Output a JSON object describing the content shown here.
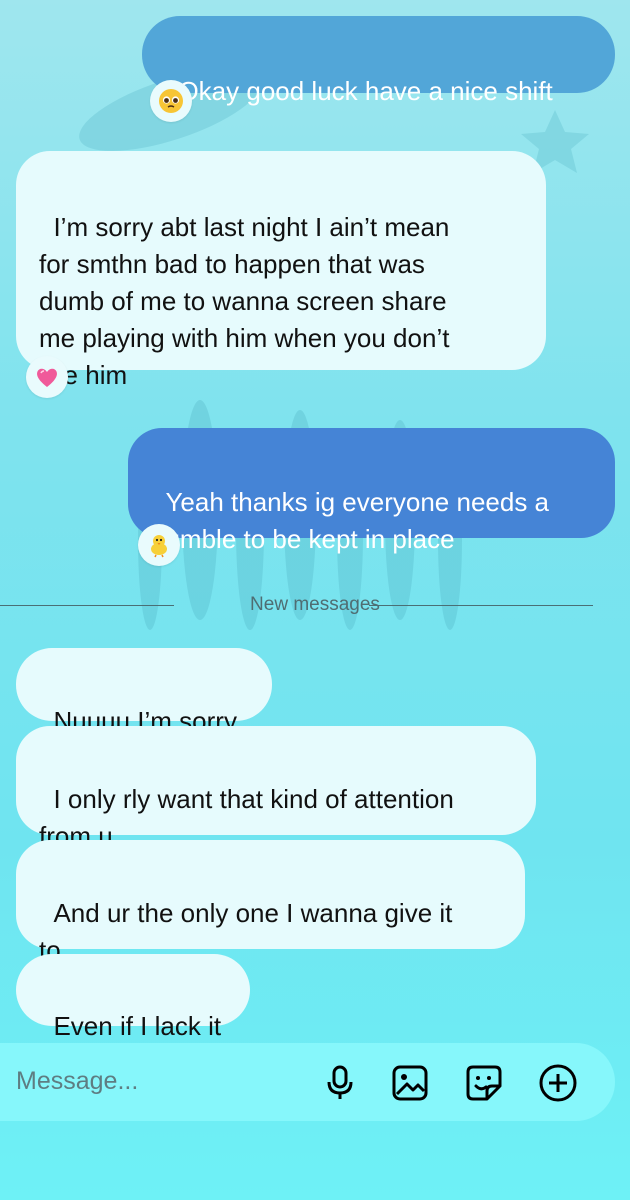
{
  "messages": [
    {
      "direction": "outgoing",
      "text": "Okay good luck have a nice shift",
      "reaction": "🥺"
    },
    {
      "direction": "incoming",
      "text": "I’m sorry abt last night I ain’t mean\nfor smthn bad to happen that was\ndumb of me to wanna screen share\nme playing with him when you don’t\nlike him",
      "reaction": "💗"
    },
    {
      "direction": "outgoing",
      "text": "Yeah thanks ig everyone needs a\nhumble to be kept in place",
      "reaction": "🐥"
    },
    {
      "direction": "incoming",
      "text": "Nuuuu I’m sorry"
    },
    {
      "direction": "incoming",
      "text": "I only rly want that kind of attention\nfrom u"
    },
    {
      "direction": "incoming",
      "text": "And ur the only one I wanna give it\nto"
    },
    {
      "direction": "incoming",
      "text": "Even if I lack it"
    }
  ],
  "divider_label": "New messages",
  "composer": {
    "placeholder": "Message...",
    "icons": [
      "microphone-icon",
      "image-icon",
      "sticker-icon",
      "plus-icon"
    ]
  },
  "colors": {
    "incoming_bubble": "#e6fbfd",
    "outgoing_bubble_light": "#4fa8d8",
    "outgoing_bubble_dark": "#3f7fd6",
    "composer_bar": "#86f7fb"
  }
}
